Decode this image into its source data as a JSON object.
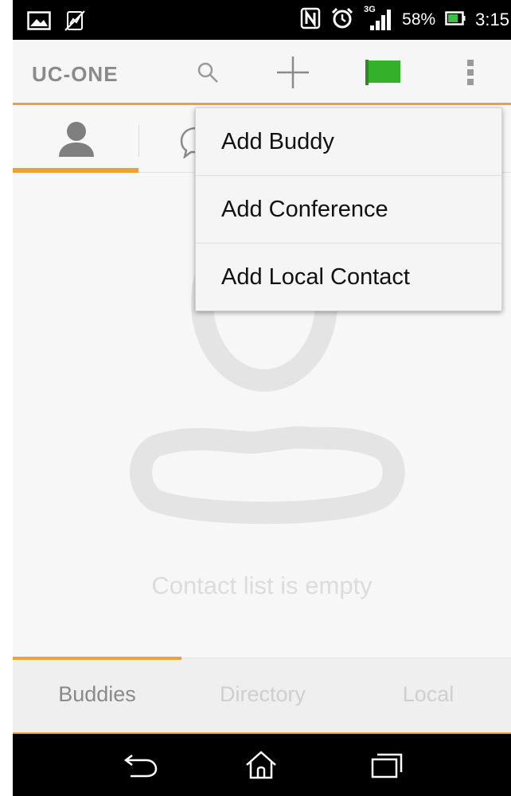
{
  "status_bar": {
    "battery_percent": "58%",
    "network": "3G",
    "time": "3:15",
    "icons": [
      "gallery-icon",
      "sim-icon",
      "nfc-icon",
      "alarm-icon",
      "signal-icon",
      "battery-icon"
    ]
  },
  "action_bar": {
    "app_title": "UC-ONE",
    "icons": [
      "search-icon",
      "add-icon",
      "presence-flag-icon",
      "overflow-menu-icon"
    ],
    "presence_color": "#35b02a",
    "accent_color": "#f0a136"
  },
  "top_tabs": {
    "icons": [
      "contacts-person-icon",
      "chat-bubble-icon"
    ],
    "selected": "contacts-person-icon"
  },
  "popup_menu": {
    "items": [
      "Add Buddy",
      "Add Conference",
      "Add Local Contact"
    ]
  },
  "empty_state": {
    "message": "Contact list is empty",
    "icon": "empty-contact-icon"
  },
  "bottom_tabs": {
    "items": [
      "Buddies",
      "Directory",
      "Local"
    ],
    "selected": "Buddies"
  },
  "nav_bar": {
    "icons": [
      "back-icon",
      "home-icon",
      "recents-icon"
    ]
  }
}
